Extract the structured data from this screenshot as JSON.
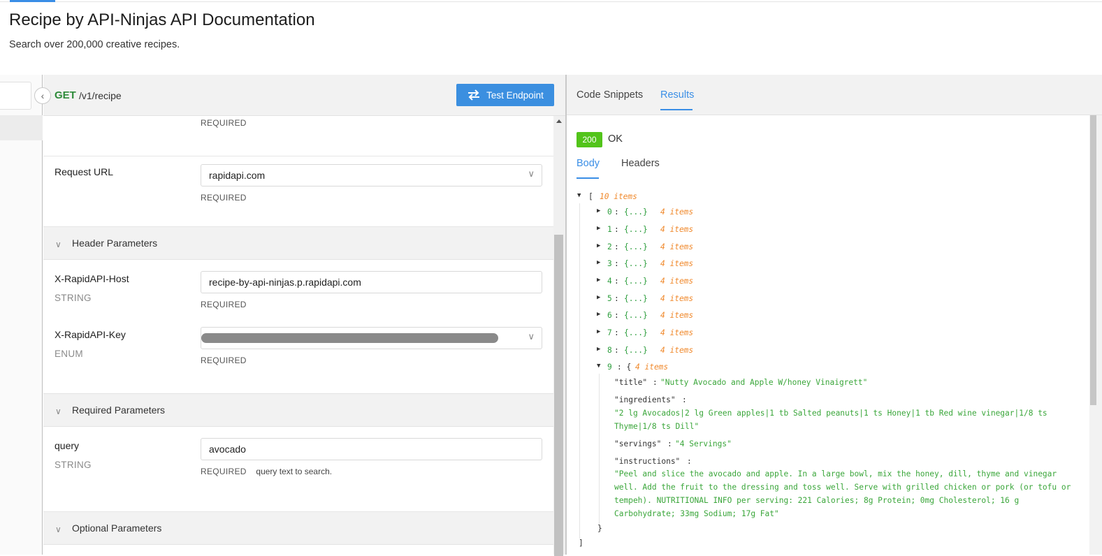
{
  "page": {
    "title": "Recipe by API-Ninjas API Documentation",
    "subtitle": "Search over 200,000 creative recipes."
  },
  "endpoint": {
    "method": "GET",
    "path": "/v1/recipe",
    "test_button": "Test Endpoint"
  },
  "params": {
    "top_required": "REQUIRED",
    "request_url": {
      "label": "Request URL",
      "value": "rapidapi.com",
      "required": "REQUIRED"
    },
    "header_section": "Header Parameters",
    "host": {
      "label": "X-RapidAPI-Host",
      "type": "STRING",
      "value": "recipe-by-api-ninjas.p.rapidapi.com",
      "required": "REQUIRED"
    },
    "key": {
      "label": "X-RapidAPI-Key",
      "type": "ENUM",
      "required": "REQUIRED"
    },
    "required_section": "Required Parameters",
    "query": {
      "label": "query",
      "type": "STRING",
      "value": "avocado",
      "required": "REQUIRED",
      "description": "query text to search."
    },
    "optional_section": "Optional Parameters"
  },
  "right": {
    "tabs": [
      "Code Snippets",
      "Results"
    ],
    "status_code": "200",
    "status_text": "OK",
    "body_tabs": [
      "Body",
      "Headers"
    ]
  },
  "response": {
    "root_open": "[",
    "root_count": "10 items",
    "collapsed_items": [
      {
        "index": "0",
        "preview": "{...}",
        "count": "4 items"
      },
      {
        "index": "1",
        "preview": "{...}",
        "count": "4 items"
      },
      {
        "index": "2",
        "preview": "{...}",
        "count": "4 items"
      },
      {
        "index": "3",
        "preview": "{...}",
        "count": "4 items"
      },
      {
        "index": "4",
        "preview": "{...}",
        "count": "4 items"
      },
      {
        "index": "5",
        "preview": "{...}",
        "count": "4 items"
      },
      {
        "index": "6",
        "preview": "{...}",
        "count": "4 items"
      },
      {
        "index": "7",
        "preview": "{...}",
        "count": "4 items"
      },
      {
        "index": "8",
        "preview": "{...}",
        "count": "4 items"
      }
    ],
    "expanded": {
      "index": "9",
      "count": "4 items",
      "title_key": "\"title\"",
      "title_value": "\"Nutty Avocado and Apple W/honey Vinaigrett\"",
      "ingredients_key": "\"ingredients\"",
      "ingredients_line1": "\"2 lg Avocados|2 lg Green apples|1 tb Salted peanuts|1 ts Honey|1 tb Red wine vinegar|1/8 ts",
      "ingredients_line2": "Thyme|1/8 ts Dill\"",
      "servings_key": "\"servings\"",
      "servings_value": "\"4 Servings\"",
      "instructions_key": "\"instructions\"",
      "instructions_line1": "\"Peel and slice the avocado and apple. In a large bowl, mix the honey, dill, thyme and vinegar",
      "instructions_line2": "well. Add the fruit to the dressing and toss well. Serve with grilled chicken or pork (or tofu or",
      "instructions_line3": "tempeh). NUTRITIONAL INFO per serving: 221 Calories; 8g Protein; 0mg Cholesterol; 16 g",
      "instructions_line4": "Carbohydrate; 33mg Sodium; 17g Fat\"",
      "close": "}"
    },
    "root_close": "]"
  }
}
